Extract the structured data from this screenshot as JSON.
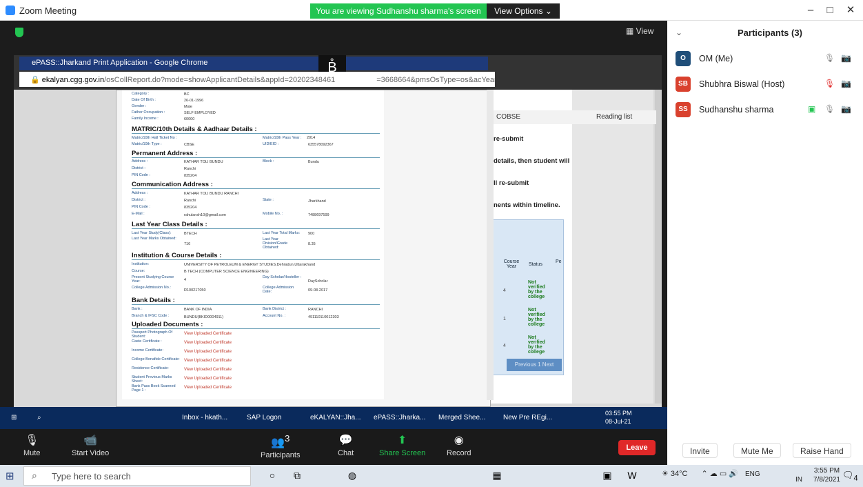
{
  "window": {
    "title": "Zoom Meeting",
    "viewing": "You are viewing Sudhanshu sharma's screen",
    "view_options": "View Options ⌄",
    "min": "–",
    "max": "□",
    "close": "✕"
  },
  "stage": {
    "view": "View"
  },
  "chrome": {
    "tab_title": "ePASS::Jharkand Print Application - Google Chrome",
    "url_host": "ekalyan.cgg.gov.in",
    "url_rest": "/osCollReport.do?mode=showApplicantDetails&appId=20202348461",
    "url_tail": "=3668664&pmsOsType=os&acYear...",
    "cobse": "COBSE",
    "reading_list": "Reading list"
  },
  "bg": {
    "l1": "re-submit",
    "l2": "details, then student will",
    "l3": "ll re-submit",
    "l4": "nents within timeline.",
    "course_year": "Course Year",
    "status": "Status",
    "pe": "Pe",
    "not_verified": "Not verified by the college",
    "n4": "4",
    "n1": "1",
    "pager": "Previous  1  Next"
  },
  "doc": {
    "personal": [
      [
        "Category :",
        "BC"
      ],
      [
        "Date Of Birth :",
        "26-01-1996"
      ],
      [
        "Gender :",
        "Male"
      ],
      [
        "Father Occupation :",
        "SELF EMPLOYED"
      ],
      [
        "Family Income :",
        "60000"
      ]
    ],
    "s_matric": "MATRIC/10th Details & Aadhaar Details :",
    "matric": {
      "l1": "Matric/10th Hall Ticket No :",
      "l2": "Matric/10th Type :",
      "v2": "CBSE",
      "l3": "Matric/10th Pass Year :",
      "v3": "2014",
      "l4": "UID/EID :",
      "v4": "635578092367"
    },
    "s_perm": "Permanent Address :",
    "perm": {
      "addr_l": "Address :",
      "addr_v": "KATHAR TOLI BUNDU",
      "dist_l": "District :",
      "dist_v": "Ranchi",
      "pin_l": "PIN Code :",
      "pin_v": "835204",
      "block_l": "Block :",
      "block_v": "Bundu"
    },
    "s_comm": "Communication Address :",
    "comm": {
      "addr_l": "Address :",
      "addr_v": "KATHAR TOLI BUNDU RANCHI",
      "dist_l": "District :",
      "dist_v": "Ranchi",
      "pin_l": "PIN Code :",
      "pin_v": "835204",
      "email_l": "E-Mail :",
      "email_v": "rahulansh10@gmail.com",
      "state_l": "State :",
      "state_v": "Jharkhand",
      "mob_l": "Mobile No. :",
      "mob_v": "7488697599"
    },
    "s_last": "Last Year Class Details :",
    "last": {
      "study_l": "Last Year Study(Class):",
      "study_v": "BTECH",
      "marks_l": "Last Year Marks Obtained:",
      "marks_v": "716",
      "total_l": "Last Year Total Marks:",
      "total_v": "900",
      "div_l": "Last Year Division/Grade Obtained:",
      "div_v": "8.35"
    },
    "s_inst": "Institution & Course Details :",
    "inst": {
      "inst_l": "Institution:",
      "inst_v": "UNIVERSITY OF PETROLEUM & ENERGY STUDIES,Dehradun,Uttarakhand",
      "course_l": "Course:",
      "course_v": "B TECH (COMPUTER SCIENCE ENGINEERING)",
      "year_l": "Present Studying Course Year:",
      "year_v": "4",
      "adm_l": "College Admission No.:",
      "adm_v": "R100217050",
      "ds_l": "Day Scholar/Hosteller :",
      "ds_v": "DayScholar",
      "date_l": "College Admission Date:",
      "date_v": "09-08-2017"
    },
    "s_bank": "Bank Details :",
    "bank": {
      "bank_l": "Bank :",
      "bank_v": "BANK OF INDIA",
      "ifsc_l": "Branch & IFSC Code :",
      "ifsc_v": "BUNDU(BKID0004911)",
      "bd_l": "Bank District :",
      "bd_v": "RANCHI",
      "acc_l": "Account No. :",
      "acc_v": "491110110012303"
    },
    "s_upl": "Uploaded Documents :",
    "uploads": [
      "Passport Photograph Of Student:",
      "Caste Certificate :",
      "Income Certificate:",
      "College Bonafide Certificate:",
      "Residence Certificate:",
      "Student Previous Marks Sheet:",
      "Bank Pass Book Scanned Page 1 :"
    ],
    "view_cert": "View Uploaded Certificate"
  },
  "rtask": {
    "inbox": "Inbox - hkath...",
    "sap": "SAP Logon",
    "ekalyan": "eKALYAN::Jha...",
    "epass": "ePASS::Jharka...",
    "merged": "Merged Shee...",
    "newpre": "New Pre REgi...",
    "time": "03:55 PM",
    "date": "08-Jul-21"
  },
  "controls": {
    "mute": "Mute",
    "video": "Start Video",
    "participants": "Participants",
    "count": "3",
    "chat": "Chat",
    "share": "Share Screen",
    "record": "Record",
    "leave": "Leave"
  },
  "panel": {
    "title": "Participants (3)",
    "people": [
      {
        "initials": "O",
        "name": "OM (Me)",
        "color": "#1f4e79"
      },
      {
        "initials": "SB",
        "name": "Shubhra Biswal (Host)",
        "color": "#d9412e"
      },
      {
        "initials": "SS",
        "name": "Sudhanshu sharma",
        "color": "#d9412e"
      }
    ],
    "invite": "Invite",
    "mute_me": "Mute Me",
    "raise": "Raise Hand"
  },
  "taskbar": {
    "search": "Type here to search",
    "temp": "34°C",
    "lang": "ENG",
    "region": "IN",
    "time": "3:55 PM",
    "date": "7/8/2021",
    "notif": "4"
  }
}
